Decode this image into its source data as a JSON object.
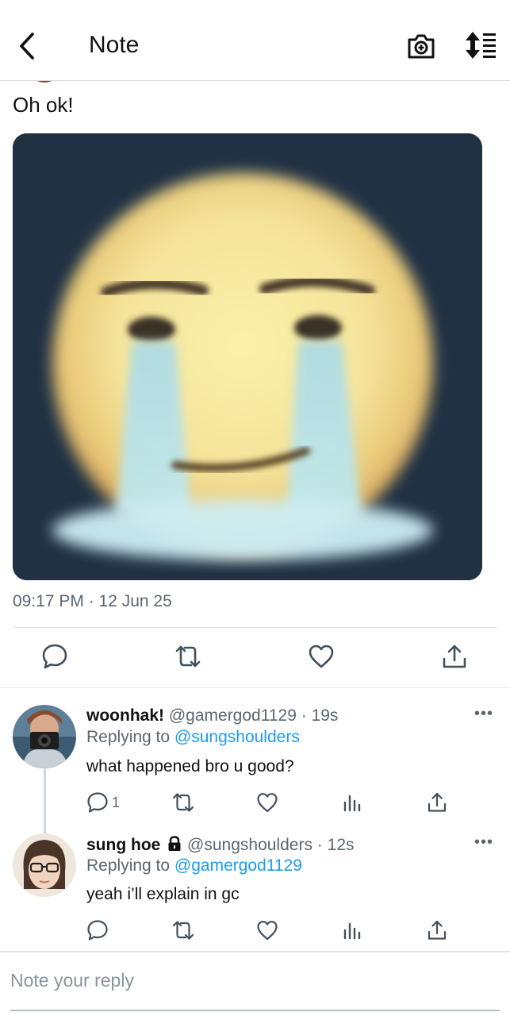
{
  "header": {
    "title": "Note",
    "back_icon": "chevron-left-icon",
    "camera_icon": "camera-plus-icon",
    "sort_icon": "sort-lines-icon"
  },
  "note": {
    "text": "Oh ok!",
    "media_description_icon": "crying-face-image",
    "timestamp": "09:17 PM · 12 Jun 25",
    "actions": [
      "reply-icon",
      "retweet-icon",
      "like-icon",
      "share-icon"
    ]
  },
  "replies": [
    {
      "name": "woonhak!",
      "handle": "@gamergod1129",
      "time": "19s",
      "replying_prefix": "Replying to",
      "replying_to": "@sungshoulders",
      "text": "what happened bro u good?",
      "reply_count": "1",
      "locked": false
    },
    {
      "name": "sung hoe",
      "handle": "@sungshoulders",
      "time": "12s",
      "replying_prefix": "Replying to",
      "replying_to": "@gamergod1129",
      "text": "yeah i’ll explain in gc",
      "reply_count": "",
      "locked": true
    }
  ],
  "compose": {
    "placeholder": "Note your reply"
  },
  "colors": {
    "accent": "#1d9bf0",
    "muted": "#5b6670",
    "text": "#111111"
  }
}
